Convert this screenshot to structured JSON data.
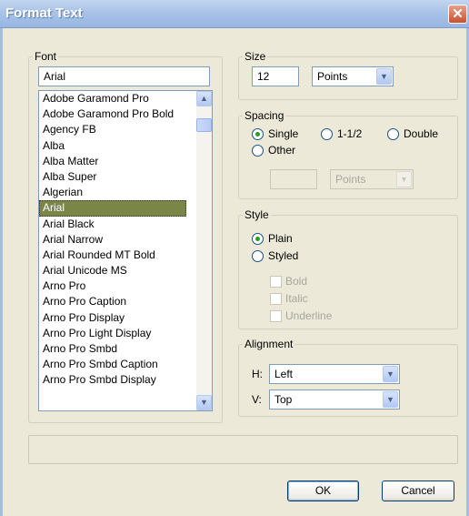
{
  "window": {
    "title": "Format Text",
    "close_glyph": "✕"
  },
  "font_group": {
    "legend": "Font",
    "current_value": "Arial",
    "list": [
      "Adobe Garamond Pro",
      "Adobe Garamond Pro Bold",
      "Agency FB",
      "Alba",
      "Alba Matter",
      "Alba Super",
      "Algerian",
      "Arial",
      "Arial Black",
      "Arial Narrow",
      "Arial Rounded MT Bold",
      "Arial Unicode MS",
      "Arno Pro",
      "Arno Pro Caption",
      "Arno Pro Display",
      "Arno Pro Light Display",
      "Arno Pro Smbd",
      "Arno Pro Smbd Caption",
      "Arno Pro Smbd Display"
    ],
    "selected_index": 7
  },
  "size_group": {
    "legend": "Size",
    "value": "12",
    "unit": "Points"
  },
  "spacing_group": {
    "legend": "Spacing",
    "options": [
      "Single",
      "1-1/2",
      "Double",
      "Other"
    ],
    "selected": "Single",
    "other_value": "",
    "other_unit": "Points"
  },
  "style_group": {
    "legend": "Style",
    "options": [
      "Plain",
      "Styled"
    ],
    "selected": "Plain",
    "checkboxes": [
      "Bold",
      "Italic",
      "Underline"
    ]
  },
  "alignment_group": {
    "legend": "Alignment",
    "h_label": "H:",
    "h_value": "Left",
    "v_label": "V:",
    "v_value": "Top"
  },
  "buttons": {
    "ok": "OK",
    "cancel": "Cancel"
  }
}
